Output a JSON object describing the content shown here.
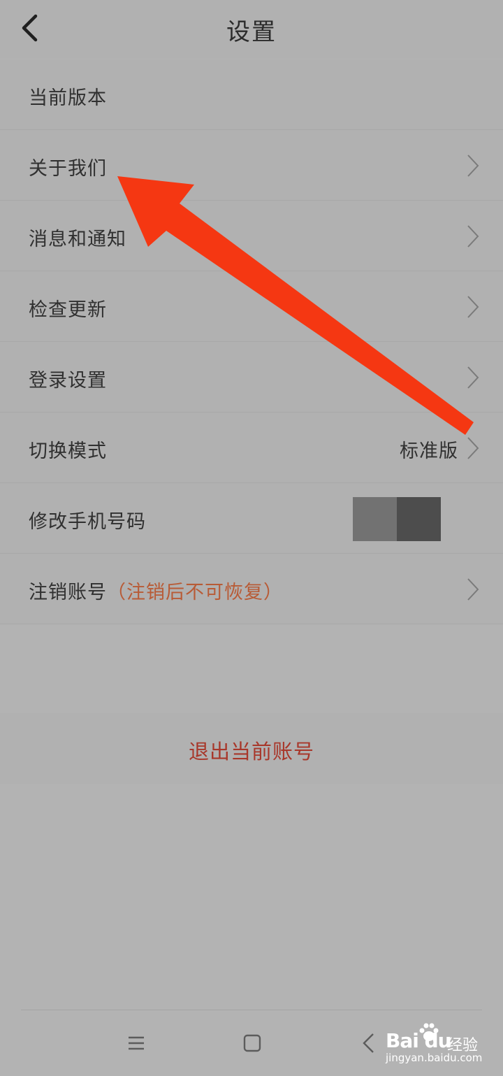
{
  "header": {
    "title": "设置"
  },
  "rows": [
    {
      "label": "当前版本"
    },
    {
      "label": "关于我们"
    },
    {
      "label": "消息和通知"
    },
    {
      "label": "检查更新"
    },
    {
      "label": "登录设置"
    },
    {
      "label": "切换模式",
      "value": "标准版"
    },
    {
      "label": "修改手机号码"
    },
    {
      "label": "注销账号",
      "warning": "（注销后不可恢复）"
    }
  ],
  "logout": {
    "label": "退出当前账号"
  },
  "watermark": {
    "brand": "Bai du",
    "cn": "经验",
    "sub": "jingyan.baidu.com"
  },
  "colors": {
    "annotation_arrow": "#f53712",
    "warning_text": "#b85b36",
    "logout_text": "#a8372a"
  }
}
